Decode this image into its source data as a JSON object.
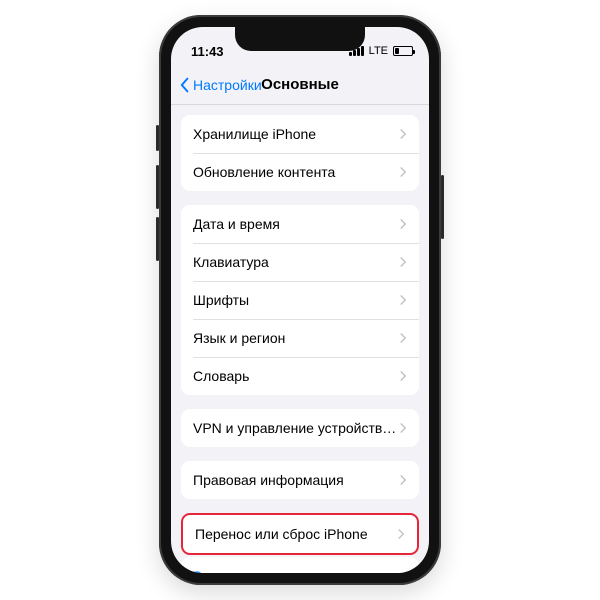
{
  "statusbar": {
    "time": "11:43",
    "carrier": "LTE"
  },
  "nav": {
    "back": "Настройки",
    "title": "Основные"
  },
  "groups": [
    {
      "rows": [
        {
          "label": "Хранилище iPhone"
        },
        {
          "label": "Обновление контента"
        }
      ]
    },
    {
      "rows": [
        {
          "label": "Дата и время"
        },
        {
          "label": "Клавиатура"
        },
        {
          "label": "Шрифты"
        },
        {
          "label": "Язык и регион"
        },
        {
          "label": "Словарь"
        }
      ]
    },
    {
      "rows": [
        {
          "label": "VPN и управление устройством"
        }
      ]
    },
    {
      "rows": [
        {
          "label": "Правовая информация"
        }
      ]
    },
    {
      "highlighted": true,
      "rows": [
        {
          "label": "Перенос или сброс iPhone"
        }
      ]
    },
    {
      "plain": true,
      "rows": [
        {
          "label": "Выключить",
          "link": true,
          "nochev": true
        }
      ]
    }
  ]
}
